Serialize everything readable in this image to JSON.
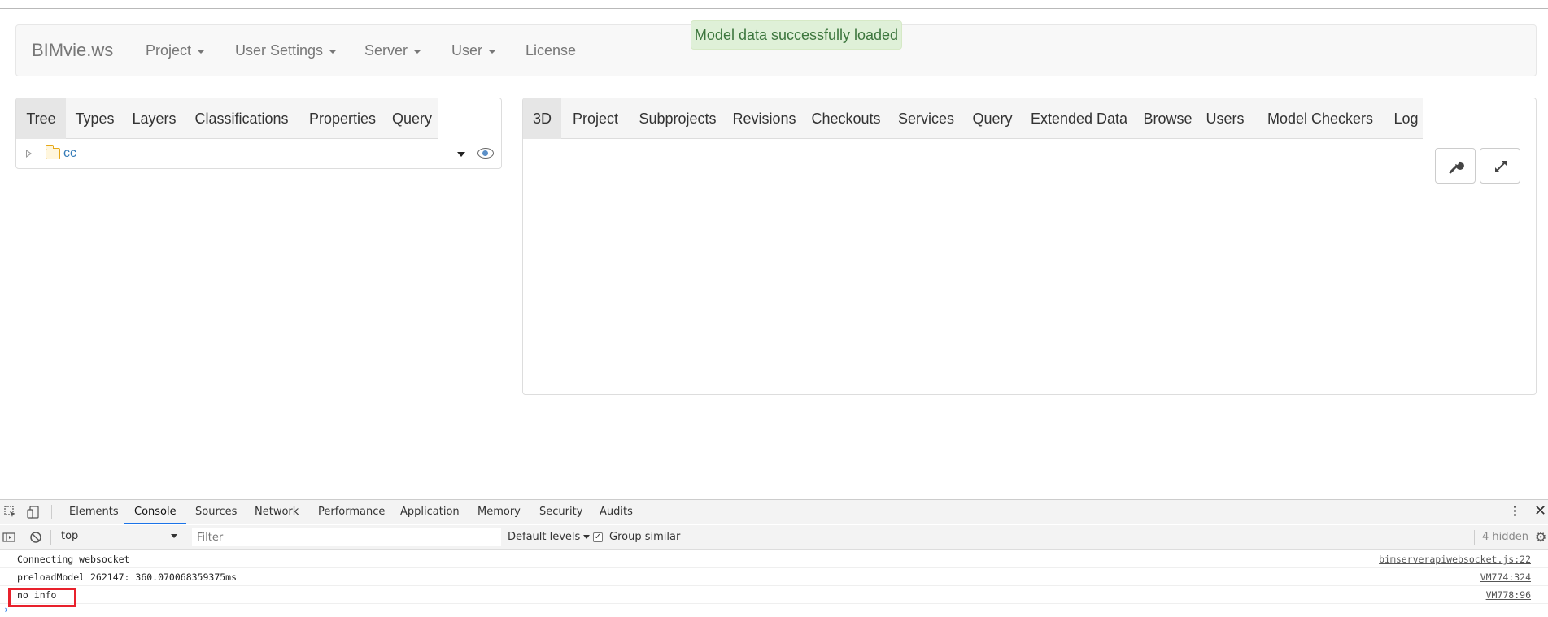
{
  "navbar": {
    "brand": "BIMvie.ws",
    "items": [
      {
        "label": "Project",
        "dropdown": true
      },
      {
        "label": "User Settings",
        "dropdown": true
      },
      {
        "label": "Server",
        "dropdown": true
      },
      {
        "label": "User",
        "dropdown": true
      },
      {
        "label": "License",
        "dropdown": false
      }
    ]
  },
  "alert": {
    "text": "Model data successfully loaded",
    "color": "#3c763d"
  },
  "left_panel": {
    "tabs": [
      "Tree",
      "Types",
      "Layers",
      "Classifications",
      "Properties",
      "Query"
    ],
    "active_tab": "Tree",
    "tree": [
      {
        "label": "cc",
        "icon": "folder-icon"
      }
    ]
  },
  "right_panel": {
    "tabs": [
      "3D",
      "Project",
      "Subprojects",
      "Revisions",
      "Checkouts",
      "Services",
      "Query",
      "Extended Data",
      "Browse",
      "Users",
      "Model Checkers",
      "Log"
    ],
    "active_tab": "3D",
    "tools": [
      "wrench-icon",
      "expand-icon"
    ]
  },
  "devtools": {
    "tabs": [
      "Elements",
      "Console",
      "Sources",
      "Network",
      "Performance",
      "Application",
      "Memory",
      "Security",
      "Audits"
    ],
    "active_tab": "Console",
    "context": "top",
    "filter_placeholder": "Filter",
    "levels": "Default levels",
    "group_similar": "Group similar",
    "group_similar_checked": true,
    "hidden": "4 hidden",
    "logs": [
      {
        "message": "Connecting websocket",
        "source": "bimserverapiwebsocket.js:22"
      },
      {
        "message": "preloadModel 262147: 360.070068359375ms",
        "source": "VM774:324"
      },
      {
        "message": "no info",
        "source": "VM778:96"
      }
    ],
    "highlight_color": "#e8212c"
  }
}
